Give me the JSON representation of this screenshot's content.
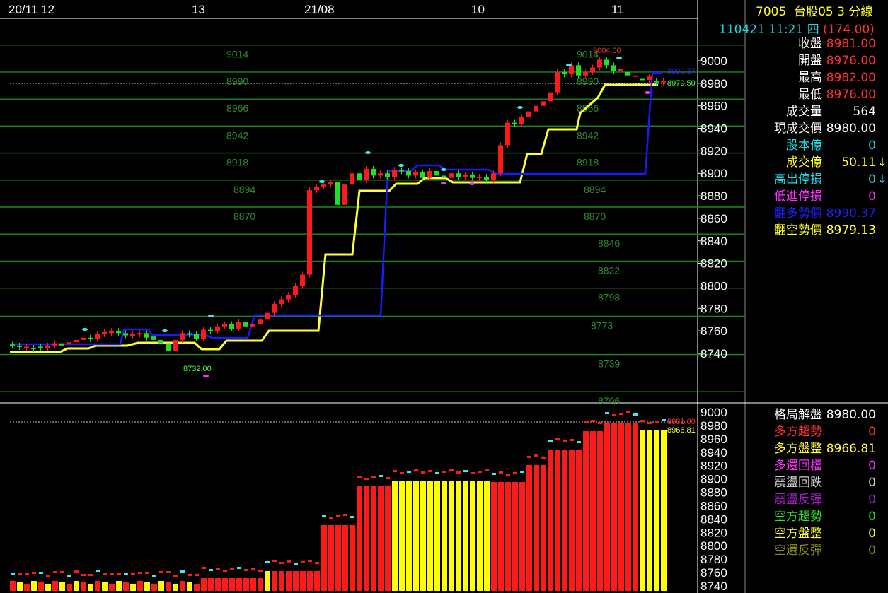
{
  "dates": [
    {
      "label": "20/11 12"
    },
    {
      "label": "13"
    },
    {
      "label": "21/08"
    },
    {
      "label": "10"
    },
    {
      "label": "11"
    }
  ],
  "top_axis": [
    "9000",
    "8980",
    "8960",
    "8940",
    "8920",
    "8900",
    "8880",
    "8860",
    "8840",
    "8820",
    "8800",
    "8780",
    "8760",
    "8740"
  ],
  "bottom_axis": [
    "9000",
    "8980",
    "8960",
    "8940",
    "8920",
    "8900",
    "8880",
    "8860",
    "8840",
    "8820",
    "8800",
    "8780",
    "8760",
    "8740"
  ],
  "levels_left": [
    "9014",
    "8990",
    "8966",
    "8942",
    "8918",
    "8894",
    "8870"
  ],
  "levels_right": [
    "9014",
    "8990",
    "8966",
    "8942",
    "8918",
    "8894",
    "8870",
    "8846",
    "8822",
    "8798",
    "8773",
    "8739",
    "8706"
  ],
  "annotations": {
    "high_mark": "9004.00",
    "low_mark": "8732.00",
    "blue_value": "8990.37",
    "green_value": "8979.50",
    "bottom_red": "8981.00",
    "bottom_yellow": "8966.81"
  },
  "header": {
    "symbol": "7005",
    "name": "台股05 3 分線",
    "datetime": "110421 11:21 四",
    "change": "(174.00)"
  },
  "quote_rows": [
    {
      "label": "收盤",
      "value": "8981.00",
      "label_color": "#ffffff",
      "value_color": "#ff3030"
    },
    {
      "label": "開盤",
      "value": "8976.00",
      "label_color": "#ffffff",
      "value_color": "#ff3030"
    },
    {
      "label": "最高",
      "value": "8982.00",
      "label_color": "#ffffff",
      "value_color": "#ff3030"
    },
    {
      "label": "最低",
      "value": "8976.00",
      "label_color": "#ffffff",
      "value_color": "#ff3030"
    },
    {
      "label": "成交量",
      "value": "564",
      "label_color": "#ffffff",
      "value_color": "#ffffff"
    },
    {
      "label": "現成交價",
      "value": "8980.00",
      "label_color": "#ffffff",
      "value_color": "#ffffff"
    },
    {
      "label": "股本億",
      "value": "0",
      "label_color": "#20d8e0",
      "value_color": "#20d8e0"
    },
    {
      "label": "成交億",
      "value": "50.11",
      "label_color": "#ffff30",
      "value_color": "#ffff30",
      "arrow": "↓",
      "arrow_color": "#ffff30"
    },
    {
      "label": "高出停損",
      "value": "0",
      "label_color": "#20d8e0",
      "value_color": "#20d8e0",
      "arrow": "↓",
      "arrow_color": "#20d8e0"
    },
    {
      "label": "低進停損",
      "value": "0",
      "label_color": "#ff30ff",
      "value_color": "#ff30ff"
    },
    {
      "label": "翻多勢價",
      "value": "8990.37",
      "label_color": "#2020ff",
      "value_color": "#2020ff"
    },
    {
      "label": "翻空勢價",
      "value": "8979.13",
      "label_color": "#ffff30",
      "value_color": "#ffff30"
    }
  ],
  "trend_rows": [
    {
      "label": "格局解盤",
      "value": "8980.00",
      "label_color": "#ffffff",
      "value_color": "#ffffff"
    },
    {
      "label": "多方趨勢",
      "value": "0",
      "label_color": "#ff3030",
      "value_color": "#ff3030"
    },
    {
      "label": "多方盤整",
      "value": "8966.81",
      "label_color": "#ffff30",
      "value_color": "#ffff30"
    },
    {
      "label": "多還回檔",
      "value": "0",
      "label_color": "#ff30ff",
      "value_color": "#ff30ff"
    },
    {
      "label": "震盪回跌",
      "value": "0",
      "label_color": "#d0d0d0",
      "value_color": "#d0d0d0"
    },
    {
      "label": "震盪反彈",
      "value": "0",
      "label_color": "#a020c0",
      "value_color": "#a020c0"
    },
    {
      "label": "空方趨勢",
      "value": "0",
      "label_color": "#30e030",
      "value_color": "#30e030"
    },
    {
      "label": "空方盤整",
      "value": "0",
      "label_color": "#ffff30",
      "value_color": "#ffff30"
    },
    {
      "label": "空還反彈",
      "value": "0",
      "label_color": "#8b8b20",
      "value_color": "#8b8b20"
    }
  ],
  "colors": {
    "up": "#ff1a1a",
    "down": "#20e020",
    "blue_line": "#1a1aff",
    "yellow_line": "#ffff30",
    "grid": "#1e8a1e",
    "cyan": "#40e8f0",
    "magenta": "#ff30ff",
    "bar_yellow": "#ffff00",
    "bar_red": "#ff1a1a"
  },
  "chart_data": {
    "type": "candlestick",
    "note_series": [
      "candles",
      "flip_long_line",
      "flip_short_line",
      "pattern_bars"
    ],
    "candles": [
      [
        8748,
        8747
      ],
      [
        8747,
        8746
      ],
      [
        8745,
        8746
      ],
      [
        8745,
        8744
      ],
      [
        8746,
        8745
      ],
      [
        8745,
        8747
      ],
      [
        8747,
        8749
      ],
      [
        8749,
        8747
      ],
      [
        8748,
        8750
      ],
      [
        8750,
        8752
      ],
      [
        8752,
        8754
      ],
      [
        8754,
        8753
      ],
      [
        8753,
        8757
      ],
      [
        8757,
        8759
      ],
      [
        8758,
        8760
      ],
      [
        8760,
        8758
      ],
      [
        8758,
        8756
      ],
      [
        8756,
        8757
      ],
      [
        8757,
        8758
      ],
      [
        8758,
        8754
      ],
      [
        8755,
        8752
      ],
      [
        8752,
        8749
      ],
      [
        8749,
        8742
      ],
      [
        8742,
        8752
      ],
      [
        8752,
        8758
      ],
      [
        8758,
        8757
      ],
      [
        8757,
        8753
      ],
      [
        8753,
        8761
      ],
      [
        8761,
        8760
      ],
      [
        8760,
        8764
      ],
      [
        8764,
        8766
      ],
      [
        8766,
        8762
      ],
      [
        8762,
        8768
      ],
      [
        8768,
        8764
      ],
      [
        8764,
        8766
      ],
      [
        8766,
        8770
      ],
      [
        8770,
        8776
      ],
      [
        8776,
        8784
      ],
      [
        8784,
        8788
      ],
      [
        8788,
        8792
      ],
      [
        8792,
        8800
      ],
      [
        8800,
        8810
      ],
      [
        8810,
        8885
      ],
      [
        8885,
        8888
      ],
      [
        8888,
        8890
      ],
      [
        8890,
        8892
      ],
      [
        8892,
        8872
      ],
      [
        8872,
        8890
      ],
      [
        8890,
        8900
      ],
      [
        8900,
        8894
      ],
      [
        8894,
        8904
      ],
      [
        8904,
        8898
      ],
      [
        8898,
        8900
      ],
      [
        8900,
        8897
      ],
      [
        8897,
        8903
      ],
      [
        8903,
        8902
      ],
      [
        8902,
        8898
      ],
      [
        8898,
        8901
      ],
      [
        8901,
        8896
      ],
      [
        8896,
        8902
      ],
      [
        8902,
        8898
      ],
      [
        8898,
        8896
      ],
      [
        8896,
        8900
      ],
      [
        8900,
        8897
      ],
      [
        8897,
        8899
      ],
      [
        8899,
        8896
      ],
      [
        8896,
        8897
      ],
      [
        8897,
        8894
      ],
      [
        8894,
        8900
      ],
      [
        8900,
        8925
      ],
      [
        8925,
        8945
      ],
      [
        8945,
        8944
      ],
      [
        8944,
        8950
      ],
      [
        8950,
        8955
      ],
      [
        8955,
        8960
      ],
      [
        8960,
        8964
      ],
      [
        8964,
        8972
      ],
      [
        8972,
        8990
      ],
      [
        8990,
        8988
      ],
      [
        8988,
        8996
      ],
      [
        8996,
        8987
      ],
      [
        8987,
        8990
      ],
      [
        8990,
        8994
      ],
      [
        8994,
        9001
      ],
      [
        9001,
        8996
      ],
      [
        8996,
        8991
      ],
      [
        8991,
        8993
      ],
      [
        8990,
        8987
      ],
      [
        8986,
        8987
      ],
      [
        8984,
        8983
      ],
      [
        8983,
        8986
      ],
      [
        8982,
        8981
      ],
      [
        8981,
        8982
      ]
    ],
    "x_ticks": [
      "20/11 12",
      "13",
      "21/08",
      "10",
      "11"
    ],
    "y_range": [
      8706,
      9014
    ]
  }
}
